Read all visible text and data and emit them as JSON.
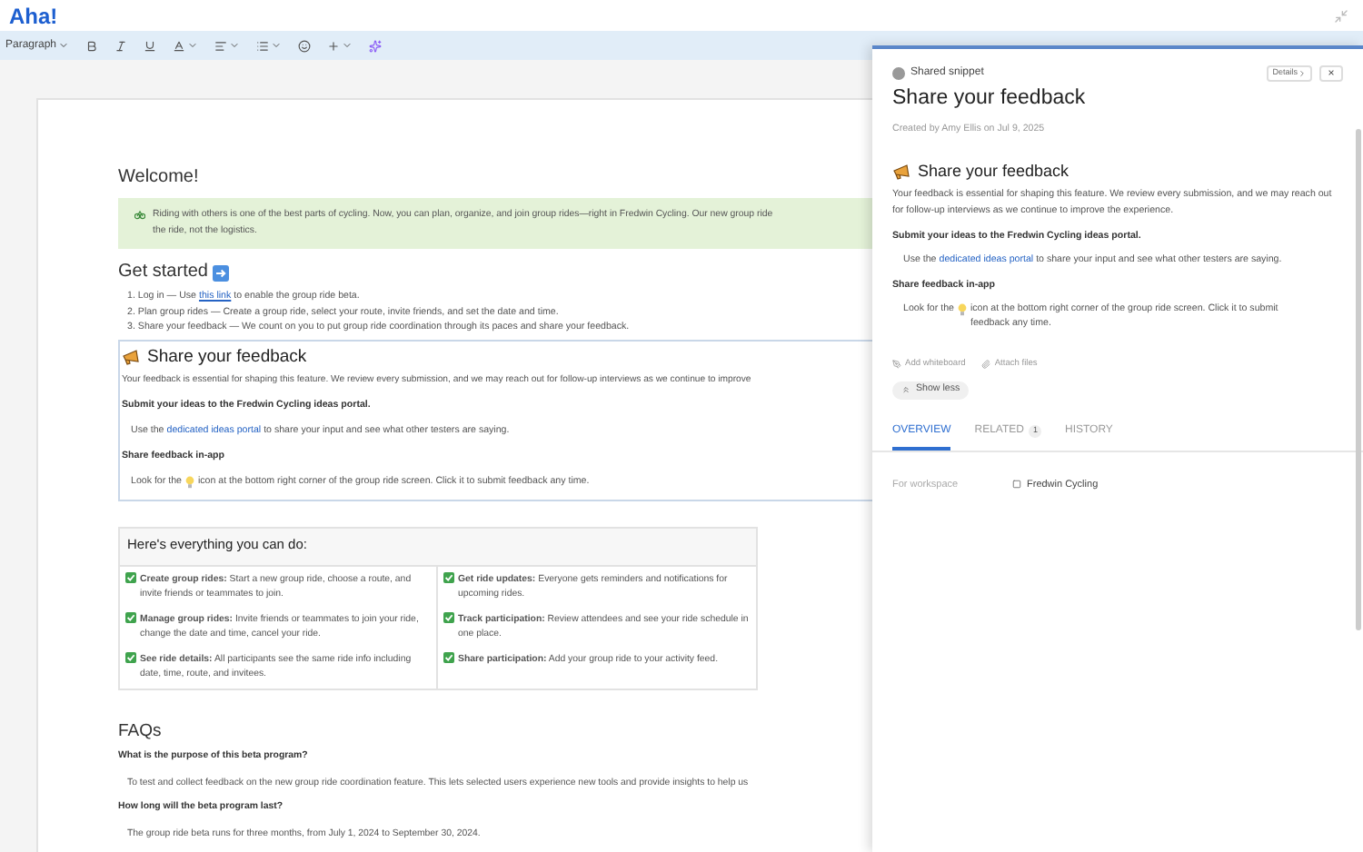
{
  "app": {
    "logo": "Aha!"
  },
  "toolbar": {
    "style_dropdown": "Paragraph"
  },
  "document": {
    "welcome": "Welcome!",
    "banner": {
      "lines": [
        "Riding with others is one of the best parts of cycling. Now, you can plan, organize, and join group rides—right in Fredwin Cycling. Our new group ride",
        "the ride, not the logistics."
      ]
    },
    "get_started": {
      "heading": "Get started",
      "steps": [
        {
          "number": "1.",
          "before": "Log in — Use",
          "link": "this link",
          "after": "to enable the group ride beta."
        },
        {
          "number": "2.",
          "before": "Plan group rides — Create a group ride, select your route, invite friends, and set the date and time."
        },
        {
          "number": "3.",
          "before": "Share your feedback — We count on you to put group ride coordination through its paces and share your feedback."
        }
      ]
    },
    "snippet": {
      "heading": "Share your feedback",
      "intro": "Your feedback is essential for shaping this feature. We review every submission, and we may reach out for follow-up interviews as we continue to improve",
      "submit_heading": "Submit your ideas to the Fredwin Cycling ideas portal.",
      "portal": {
        "before": "Use the",
        "link": "dedicated ideas portal",
        "after": "to share your input and see what other testers are saying."
      },
      "inapp_heading": "Share feedback in-app",
      "inapp": {
        "before": "Look for the",
        "after": "icon at the bottom right corner of the group ride screen. Click it to submit feedback any time."
      }
    },
    "features": {
      "heading": "Here's everything you can do:",
      "rows": [
        [
          "**Create group rides:** Start a new group ride, choose a route, and invite friends or teammates to join.",
          "**Get ride updates:** Everyone gets reminders and notifications for upcoming rides."
        ],
        [
          "**Manage group rides:** Invite friends or teammates to join your ride, change the date and time, cancel your ride.",
          "**Track participation:** Review attendees and see your ride schedule in one place."
        ],
        [
          "**See ride details:** All participants see the same ride info including date, time, route, and invitees.",
          "**Share participation:** Add your group ride to your activity feed."
        ]
      ]
    },
    "faqs": {
      "heading": "FAQs",
      "items": [
        {
          "question": "What is the purpose of this beta program?",
          "answer": "To test and collect feedback on the new group ride coordination feature. This lets selected users experience new tools and provide insights to help us"
        },
        {
          "question": "How long will the beta program last?",
          "answer": "The group ride beta runs for three months, from July 1, 2024 to September 30, 2024."
        }
      ]
    }
  },
  "drawer": {
    "label": "Shared snippet",
    "details_button": "Details",
    "close_button": "×",
    "title": "Share your feedback",
    "created": "Created by Amy Ellis on Jul 9, 2025",
    "heading": "Share your feedback",
    "intro": "Your feedback is essential for shaping this feature. We review every submission, and we may reach out for follow-up interviews as we continue to improve the experience.",
    "submit_heading": "Submit your ideas to the Fredwin Cycling ideas portal.",
    "portal": {
      "before": "Use the",
      "link": "dedicated ideas portal",
      "after": "to share your input and see what other testers are saying."
    },
    "inapp_heading": "Share feedback in-app",
    "inapp": {
      "before": "Look for the",
      "after": "icon at the bottom right corner of the group ride screen. Click it to submit feedback any time."
    },
    "actions": [
      "Add whiteboard",
      "Attach files"
    ],
    "show_less": "Show less",
    "tabs": [
      {
        "label": "OVERVIEW",
        "selected": true
      },
      {
        "label": "RELATED",
        "count": "1",
        "selected": false
      },
      {
        "label": "HISTORY",
        "selected": false
      }
    ],
    "fields": [
      {
        "label": "For workspace",
        "value": "Fredwin Cycling"
      }
    ]
  }
}
